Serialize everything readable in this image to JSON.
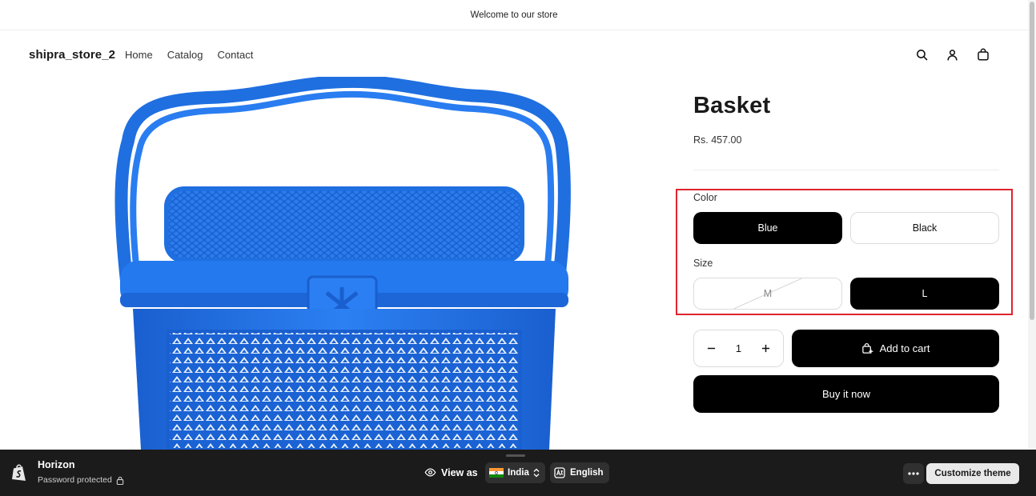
{
  "announcement": {
    "text": "Welcome to our store"
  },
  "header": {
    "logo": "shipra_store_2",
    "nav": [
      {
        "label": "Home"
      },
      {
        "label": "Catalog"
      },
      {
        "label": "Contact"
      }
    ],
    "icons": [
      "search-icon",
      "account-icon",
      "cart-icon"
    ]
  },
  "product": {
    "title": "Basket",
    "price": "Rs. 457.00",
    "image_alt": "Blue plastic basket with handle and lid",
    "color": {
      "label": "Color",
      "options": [
        {
          "label": "Blue",
          "state": "selected"
        },
        {
          "label": "Black",
          "state": "available"
        }
      ]
    },
    "size": {
      "label": "Size",
      "options": [
        {
          "label": "M",
          "state": "unavailable"
        },
        {
          "label": "L",
          "state": "selected"
        }
      ]
    },
    "quantity": {
      "value": "1",
      "decrease": "−",
      "increase": "+"
    },
    "add_to_cart": "Add to cart",
    "buy_now": "Buy it now"
  },
  "preview_bar": {
    "theme_name": "Horizon",
    "status": "Password protected",
    "view_as": "View as",
    "country": "India",
    "language": "English",
    "customize": "Customize theme"
  },
  "colors": {
    "accent": "#000000",
    "highlight_box": "#e0242b",
    "basket_blue": "#1f6fe0",
    "preview_bar_bg": "#1b1b1b"
  }
}
